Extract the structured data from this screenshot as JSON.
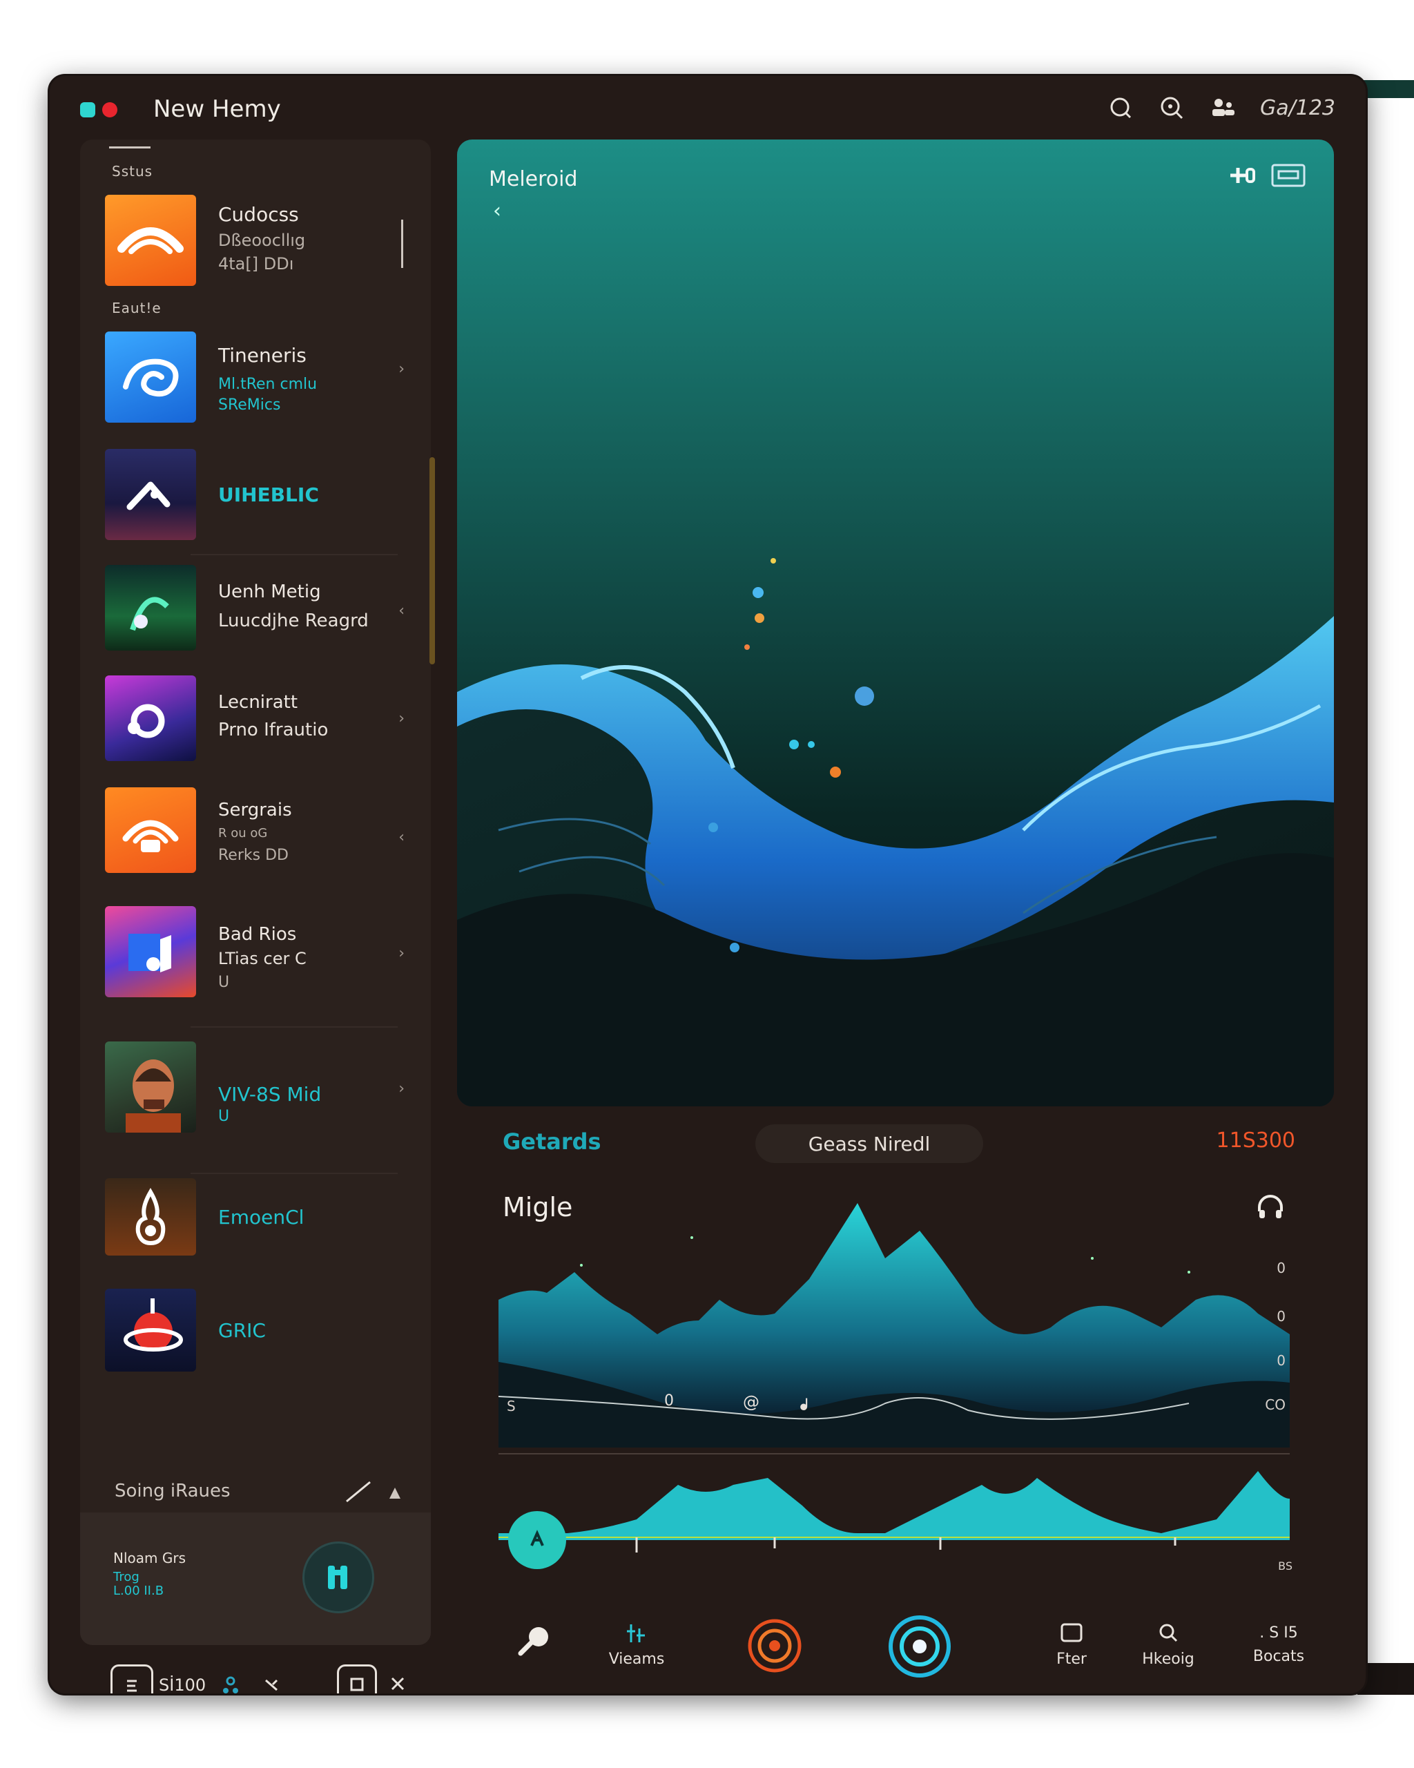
{
  "window": {
    "title": "New Hemy",
    "user": "Ga/123"
  },
  "sidebar": {
    "section_top": "Sstus",
    "section_mid": "Eaut!e",
    "items": [
      {
        "title": "Cudocss",
        "sub1": "Dßeoocllıg",
        "sub2": "4ta[] DDı",
        "accent": "#b9b0a8"
      },
      {
        "title": "Tineneris",
        "sub1": "Ml.tRen cmlu",
        "sub2": "SReMics",
        "accent": "#22c4ce"
      },
      {
        "title": "UIHEBLIC",
        "sub1": "",
        "sub2": "",
        "accent": "#22c4ce"
      },
      {
        "title": "Uenh Metig",
        "sub1": "Luucdjhe Reagrd",
        "sub2": "",
        "accent": "#e8e1da"
      },
      {
        "title": "Lecniratt",
        "sub1": "Prno Ifrautio",
        "sub2": "",
        "accent": "#e8e1da"
      },
      {
        "title": "Sergrais",
        "sub1": "R ou   oG",
        "sub2": "Rerks  DD",
        "accent": "#b9b0a8"
      },
      {
        "title": "Bad Rios",
        "sub1": "LTias cer C",
        "sub2": "U",
        "accent": "#e8e1da"
      },
      {
        "title": "VIV-8S Mid",
        "sub1": "U",
        "sub2": "",
        "accent": "#22c4ce"
      },
      {
        "title": "EmoenCl",
        "sub1": "",
        "sub2": "",
        "accent": "#22c4ce"
      },
      {
        "title": "GRIC",
        "sub1": "",
        "sub2": "",
        "accent": "#22c4ce"
      }
    ],
    "footer_label": "Soing iRaues",
    "now_playing": {
      "title": "Nloam Grs",
      "sub1": "Trog",
      "sub2": "L.00 II.B"
    },
    "bottom_label": "Sİ100"
  },
  "hero": {
    "title": "Meleroid"
  },
  "panel": {
    "left": "Getards",
    "pill": "Geass Niredl",
    "right": "11S300",
    "section": "Migle",
    "yticks": [
      "0",
      "0",
      "0",
      "CO"
    ],
    "xmarks": [
      "S",
      "0",
      "@",
      "ᖱ"
    ],
    "wave_end": "BS"
  },
  "nav": [
    {
      "label": "",
      "icon": "music-key-icon"
    },
    {
      "label": "Vieams",
      "icon": "equalizer-icon"
    },
    {
      "label": "",
      "icon": "orange-spiral-icon"
    },
    {
      "label": "",
      "icon": "blue-disc-icon"
    },
    {
      "label": "Fter",
      "icon": "frame-icon"
    },
    {
      "label": "Hkeoig",
      "icon": "search-icon"
    },
    {
      "label": "Bocats",
      "icon": "dots-icon",
      "top": ". S  I5"
    }
  ],
  "colors": {
    "accent_teal": "#22c4ce",
    "accent_orange": "#f0562a",
    "window_bg": "#241a17"
  }
}
